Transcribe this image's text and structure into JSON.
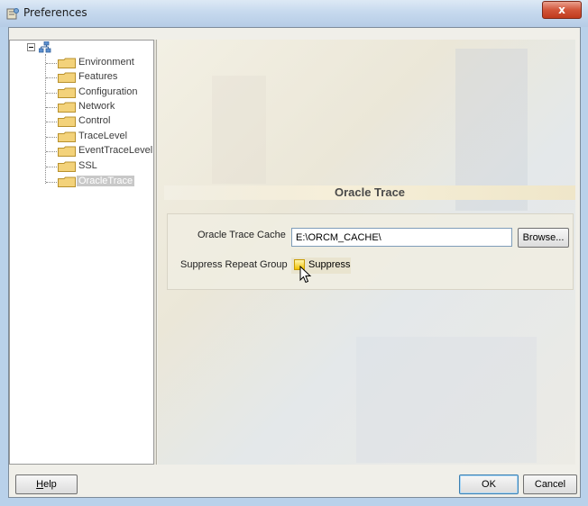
{
  "window": {
    "title": "Preferences",
    "close_glyph": "x"
  },
  "tree": {
    "root_icon": "network-icon",
    "items": [
      {
        "label": "Environment"
      },
      {
        "label": "Features"
      },
      {
        "label": "Configuration"
      },
      {
        "label": "Network"
      },
      {
        "label": "Control"
      },
      {
        "label": "TraceLevel"
      },
      {
        "label": "EventTraceLevel"
      },
      {
        "label": "SSL"
      },
      {
        "label": "OracleTrace",
        "selected": true
      }
    ]
  },
  "section": {
    "title": "Oracle Trace"
  },
  "form": {
    "cache_label": "Oracle Trace Cache",
    "cache_value": "E:\\ORCM_CACHE\\",
    "browse_label": "Browse...",
    "suppress_label": "Suppress Repeat Group",
    "suppress_checkbox_label": "Suppress",
    "suppress_checked": false
  },
  "buttons": {
    "help_mnemonic": "H",
    "help_rest": "elp",
    "ok": "OK",
    "cancel": "Cancel"
  },
  "colors": {
    "title_bar": "#c6d9ee",
    "close_button": "#d2553a",
    "selection": "#c8c8c8",
    "section_header": "#f6efd9"
  }
}
